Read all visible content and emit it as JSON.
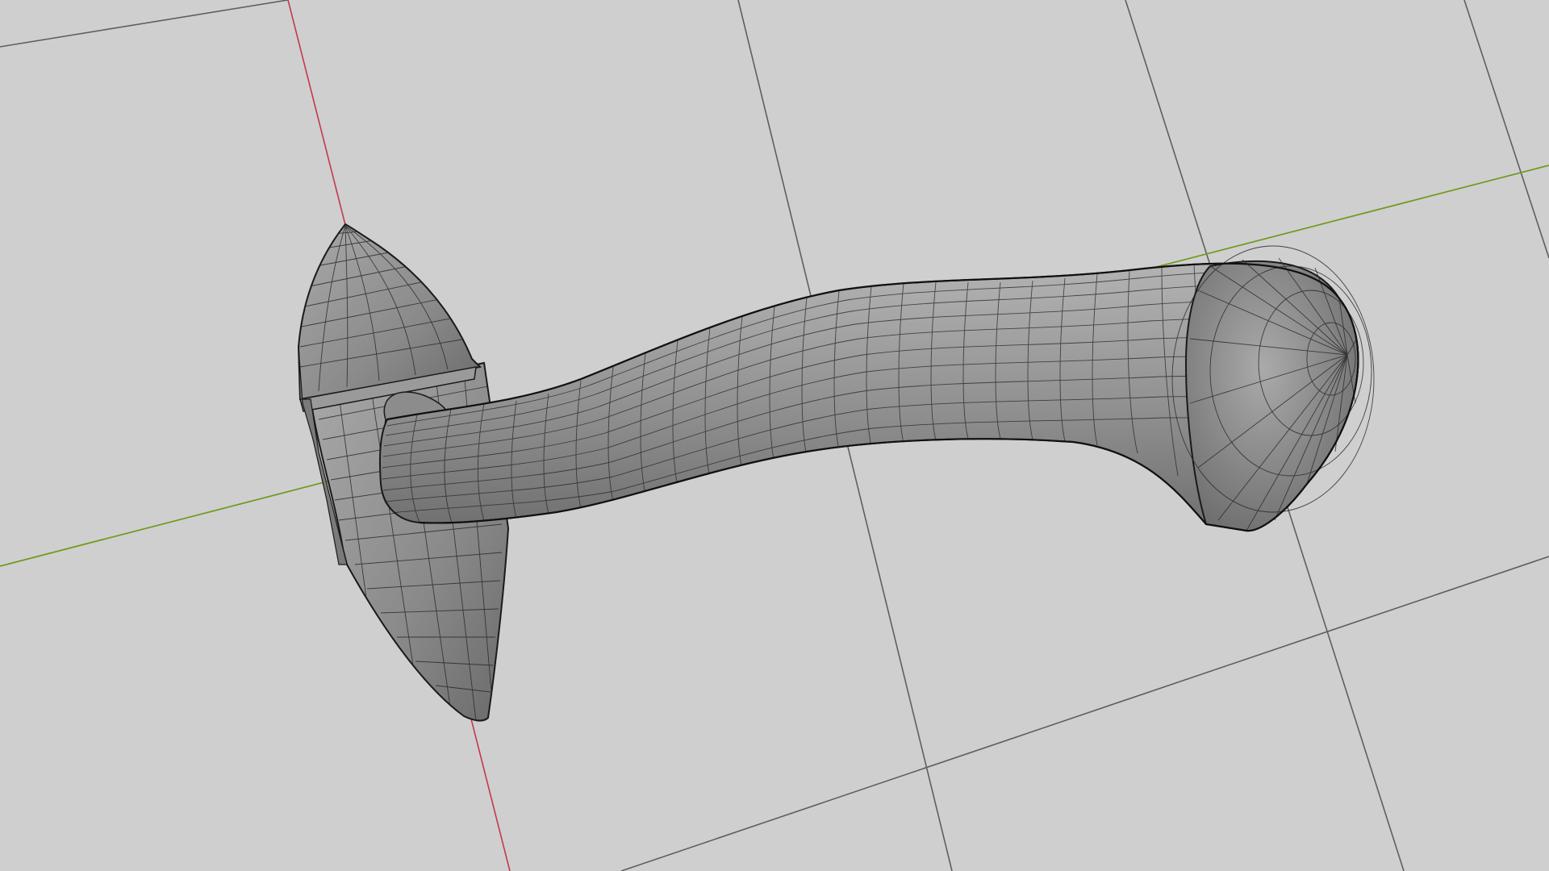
{
  "viewport": {
    "background_color": "#cfcfcf",
    "grid_color": "#5f5f5f",
    "x_axis_color": "#c23a48",
    "y_axis_color": "#6f9a1e",
    "mesh_fill_color": "#8f8f8f",
    "mesh_wire_color": "#2a2a2a"
  },
  "scene": {
    "object_name": "",
    "display_mode": "wireframe-on-shaded"
  }
}
